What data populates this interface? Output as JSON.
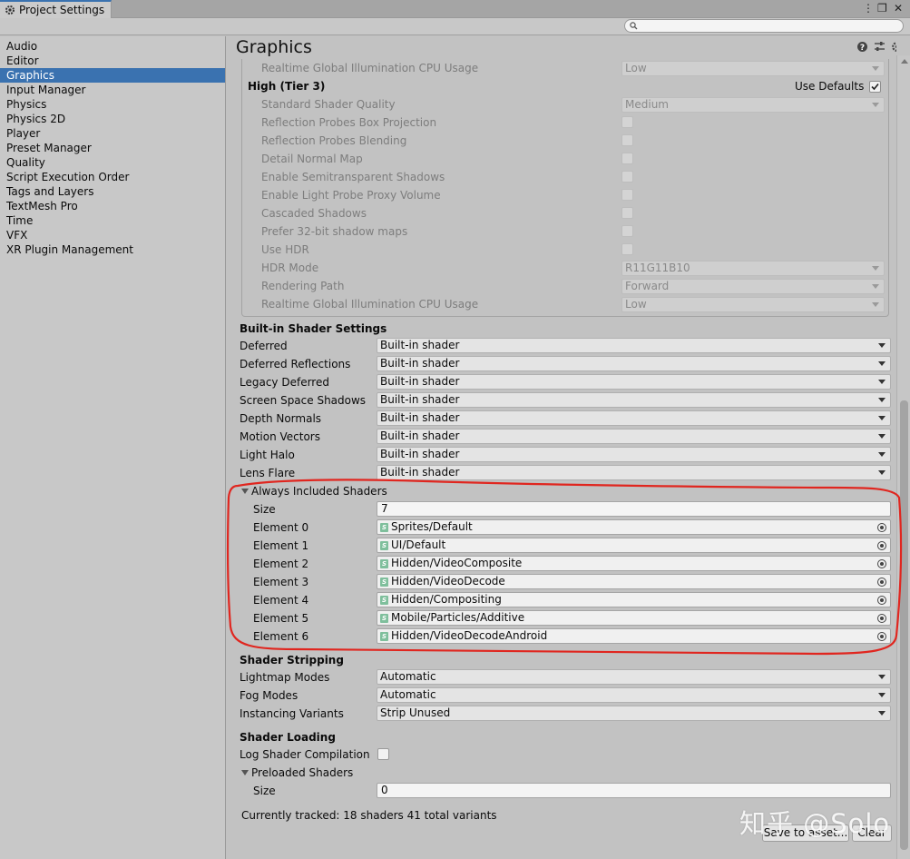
{
  "window": {
    "tab_title": "Project Settings",
    "controls": [
      "⋮",
      "❐",
      "✕"
    ]
  },
  "search": {
    "placeholder": ""
  },
  "sidebar": {
    "items": [
      {
        "label": "Audio"
      },
      {
        "label": "Editor"
      },
      {
        "label": "Graphics",
        "selected": true
      },
      {
        "label": "Input Manager"
      },
      {
        "label": "Physics"
      },
      {
        "label": "Physics 2D"
      },
      {
        "label": "Player"
      },
      {
        "label": "Preset Manager"
      },
      {
        "label": "Quality"
      },
      {
        "label": "Script Execution Order"
      },
      {
        "label": "Tags and Layers"
      },
      {
        "label": "TextMesh Pro"
      },
      {
        "label": "Time"
      },
      {
        "label": "VFX"
      },
      {
        "label": "XR Plugin Management"
      }
    ]
  },
  "page": {
    "title": "Graphics",
    "icons": [
      "help-icon",
      "preset-icon",
      "settings-icon"
    ]
  },
  "tier": {
    "prev_row": {
      "label": "Realtime Global Illumination CPU Usage",
      "value": "Low"
    },
    "title": "High (Tier 3)",
    "use_defaults_label": "Use Defaults",
    "use_defaults_checked": true,
    "rows": [
      {
        "label": "Standard Shader Quality",
        "kind": "dropdown",
        "value": "Medium"
      },
      {
        "label": "Reflection Probes Box Projection",
        "kind": "checkbox"
      },
      {
        "label": "Reflection Probes Blending",
        "kind": "checkbox"
      },
      {
        "label": "Detail Normal Map",
        "kind": "checkbox"
      },
      {
        "label": "Enable Semitransparent Shadows",
        "kind": "checkbox"
      },
      {
        "label": "Enable Light Probe Proxy Volume",
        "kind": "checkbox"
      },
      {
        "label": "Cascaded Shadows",
        "kind": "checkbox"
      },
      {
        "label": "Prefer 32-bit shadow maps",
        "kind": "checkbox"
      },
      {
        "label": "Use HDR",
        "kind": "checkbox"
      },
      {
        "label": "HDR Mode",
        "kind": "dropdown",
        "value": "R11G11B10"
      },
      {
        "label": "Rendering Path",
        "kind": "dropdown",
        "value": "Forward"
      },
      {
        "label": "Realtime Global Illumination CPU Usage",
        "kind": "dropdown",
        "value": "Low"
      }
    ]
  },
  "builtin": {
    "title": "Built-in Shader Settings",
    "rows": [
      {
        "label": "Deferred",
        "value": "Built-in shader"
      },
      {
        "label": "Deferred Reflections",
        "value": "Built-in shader"
      },
      {
        "label": "Legacy Deferred",
        "value": "Built-in shader"
      },
      {
        "label": "Screen Space Shadows",
        "value": "Built-in shader"
      },
      {
        "label": "Depth Normals",
        "value": "Built-in shader"
      },
      {
        "label": "Motion Vectors",
        "value": "Built-in shader"
      },
      {
        "label": "Light Halo",
        "value": "Built-in shader"
      },
      {
        "label": "Lens Flare",
        "value": "Built-in shader"
      }
    ]
  },
  "always_included": {
    "title": "Always Included Shaders",
    "size_label": "Size",
    "size": "7",
    "elements": [
      {
        "label": "Element 0",
        "value": "Sprites/Default"
      },
      {
        "label": "Element 1",
        "value": "UI/Default"
      },
      {
        "label": "Element 2",
        "value": "Hidden/VideoComposite"
      },
      {
        "label": "Element 3",
        "value": "Hidden/VideoDecode"
      },
      {
        "label": "Element 4",
        "value": "Hidden/Compositing"
      },
      {
        "label": "Element 5",
        "value": "Mobile/Particles/Additive"
      },
      {
        "label": "Element 6",
        "value": "Hidden/VideoDecodeAndroid"
      }
    ],
    "shader_icon_glyph": "S"
  },
  "stripping": {
    "title": "Shader Stripping",
    "rows": [
      {
        "label": "Lightmap Modes",
        "value": "Automatic"
      },
      {
        "label": "Fog Modes",
        "value": "Automatic"
      },
      {
        "label": "Instancing Variants",
        "value": "Strip Unused"
      }
    ]
  },
  "loading": {
    "title": "Shader Loading",
    "log_label": "Log Shader Compilation",
    "log_checked": false,
    "preloaded_title": "Preloaded Shaders",
    "size_label": "Size",
    "size": "0",
    "tracked": "Currently tracked: 18 shaders 41 total variants",
    "save_label": "Save to asset...",
    "clear_label": "Clear"
  },
  "watermark": "知乎 @Solo",
  "colors": {
    "selection": "#3a72b0",
    "annotation": "#e0261f"
  }
}
